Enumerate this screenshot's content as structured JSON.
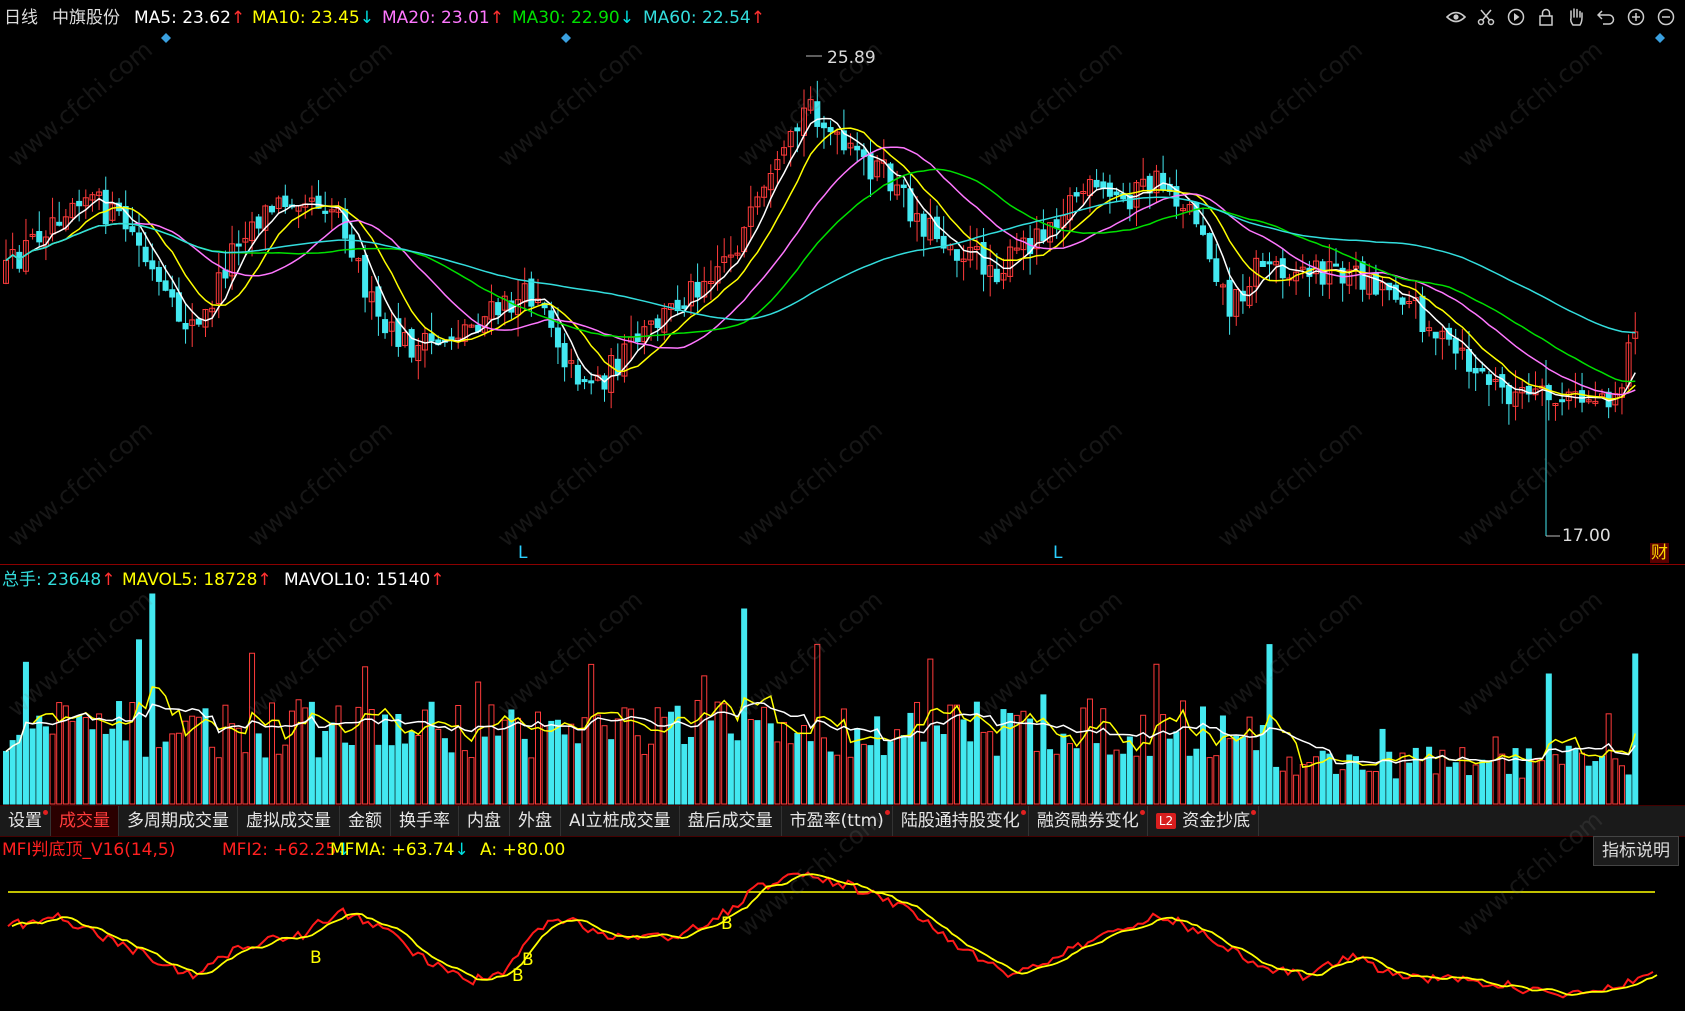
{
  "main": {
    "period": "日线",
    "stock": "中旗股份",
    "ma5": {
      "label": "MA5: 23.62",
      "arrow": "↑",
      "color": "#ffffff"
    },
    "ma10": {
      "label": "MA10: 23.45",
      "arrow": "↓",
      "color": "#ffff00"
    },
    "ma20": {
      "label": "MA20: 23.01",
      "arrow": "↑",
      "color": "#ff77ff"
    },
    "ma30": {
      "label": "MA30: 22.90",
      "arrow": "↓",
      "color": "#00e000"
    },
    "ma60": {
      "label": "MA60: 22.54",
      "arrow": "↑",
      "color": "#33dddd"
    },
    "high_label": "25.89",
    "low_label": "17.00",
    "l_marker": "L",
    "cai_badge": "财"
  },
  "volume": {
    "total_label": "总手: 23648",
    "total_arrow": "↑",
    "mavol5_label": "MAVOL5: 18728",
    "mavol5_arrow": "↑",
    "mavol10_label": "MAVOL10: 15140",
    "mavol10_arrow": "↑"
  },
  "tabs": [
    {
      "label": "设置",
      "dot": true
    },
    {
      "label": "成交量",
      "active": true
    },
    {
      "label": "多周期成交量"
    },
    {
      "label": "虚拟成交量"
    },
    {
      "label": "金额"
    },
    {
      "label": "换手率"
    },
    {
      "label": "内盘"
    },
    {
      "label": "外盘"
    },
    {
      "label": "AI立桩成交量"
    },
    {
      "label": "盘后成交量"
    },
    {
      "label": "市盈率(ttm)",
      "dot": true
    },
    {
      "label": "陆股通持股变化",
      "dot": true
    },
    {
      "label": "融资融券变化",
      "dot": true
    },
    {
      "label": "资金抄底",
      "badge": "L2",
      "dot": true
    }
  ],
  "indicator": {
    "name": "MFI判底顶_V16(14,5)",
    "mfi2_label": "MFI2: +62.25",
    "mfi2_arrow": "↓",
    "mfma_label": "MFMA: +63.74",
    "mfma_arrow": "↓",
    "a_label": "A: +80.00",
    "b_marker": "B",
    "explain_button": "指标说明"
  },
  "watermark": "www.cfchi.com",
  "icons": [
    "eye-icon",
    "scissors-icon",
    "play-icon",
    "lock-icon",
    "hand-icon",
    "undo-icon",
    "zoom-in-icon",
    "zoom-out-icon"
  ]
}
